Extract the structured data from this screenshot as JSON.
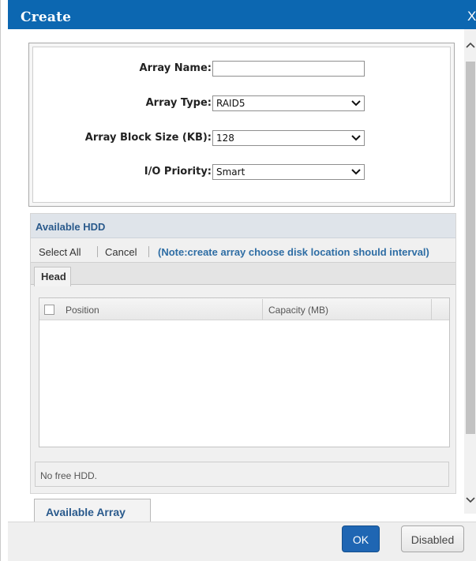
{
  "dialog": {
    "title": "Create",
    "close_glyph": "X"
  },
  "form": {
    "array_name_label": "Array Name:",
    "array_name_value": "",
    "array_type_label": "Array Type:",
    "array_type_value": "RAID5",
    "block_size_label": "Array Block Size (KB):",
    "block_size_value": "128",
    "io_priority_label": "I/O Priority:",
    "io_priority_value": "Smart"
  },
  "hdd": {
    "title": "Available HDD",
    "select_all": "Select All",
    "cancel": "Cancel",
    "note": "(Note:create array choose disk location should interval)",
    "tab_head": "Head",
    "columns": [
      "Position",
      "Capacity (MB)"
    ],
    "rows": [],
    "status": "No free HDD."
  },
  "bottom_tab": "Available Array",
  "buttons": {
    "ok": "OK",
    "disabled": "Disabled"
  },
  "icons": {
    "close": "close-icon",
    "dropdown": "chevron-down-icon",
    "scroll_up": "chevron-up-icon",
    "scroll_down": "chevron-down-icon"
  },
  "colors": {
    "titlebar": "#0c67b1",
    "accent": "#1f66b3",
    "link_blue": "#2a5a8c"
  }
}
